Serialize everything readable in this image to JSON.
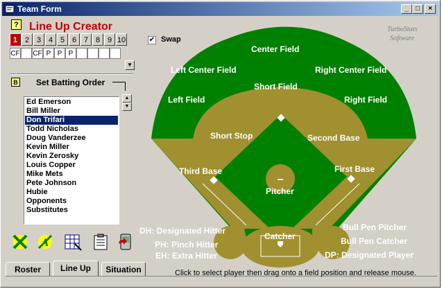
{
  "window": {
    "title": "Team Form"
  },
  "header": {
    "title": "Line Up Creator",
    "help_label": "?"
  },
  "lineup_numbers": [
    "1",
    "2",
    "3",
    "4",
    "5",
    "6",
    "7",
    "8",
    "9",
    "10"
  ],
  "positions": [
    "CF",
    "",
    "CF",
    "P",
    "P",
    "P",
    "",
    "",
    "",
    ""
  ],
  "swap": {
    "label": "Swap",
    "checked": "✔"
  },
  "brand": {
    "line1": "TurboStats",
    "line2": "Software"
  },
  "batting": {
    "badge": "B",
    "title": "Set Batting Order"
  },
  "players": [
    "Ed Emerson",
    "Bill Miller",
    "Don Trifari",
    "Todd Nicholas",
    "Doug Vanderzee",
    "Kevin Miller",
    "Kevin Zerosky",
    "Louis Copper",
    "Mike Mets",
    "Pete Johnson",
    "Hubie",
    "Opponents",
    "Substitutes"
  ],
  "selected_player": "Don Trifari",
  "field_labels": {
    "center_field": "Center Field",
    "left_center_field": "Left Center Field",
    "right_center_field": "Right Center Field",
    "left_field": "Left Field",
    "right_field": "Right Field",
    "short_field": "Short Field",
    "short_stop": "Short Stop",
    "second_base": "Second Base",
    "third_base": "Third Base",
    "first_base": "First Base",
    "pitcher": "Pitcher",
    "catcher": "Catcher"
  },
  "extra_positions": {
    "dh": "DH: Designated Hitter",
    "ph": "PH: Pinch Hitter",
    "eh": "EH: Extra Hitter",
    "bpp": "Bull Pen Pitcher",
    "bpc": "Bull Pen Catcher",
    "dp": "DP: Designated Player"
  },
  "tabs": [
    "Roster",
    "Line Up",
    "Situation"
  ],
  "active_tab": "Line Up",
  "status": "Click to select player then drag onto a field position and release mouse.",
  "colors": {
    "grass": "#008000",
    "dirt": "#a09030",
    "title_red": "#c00000"
  }
}
